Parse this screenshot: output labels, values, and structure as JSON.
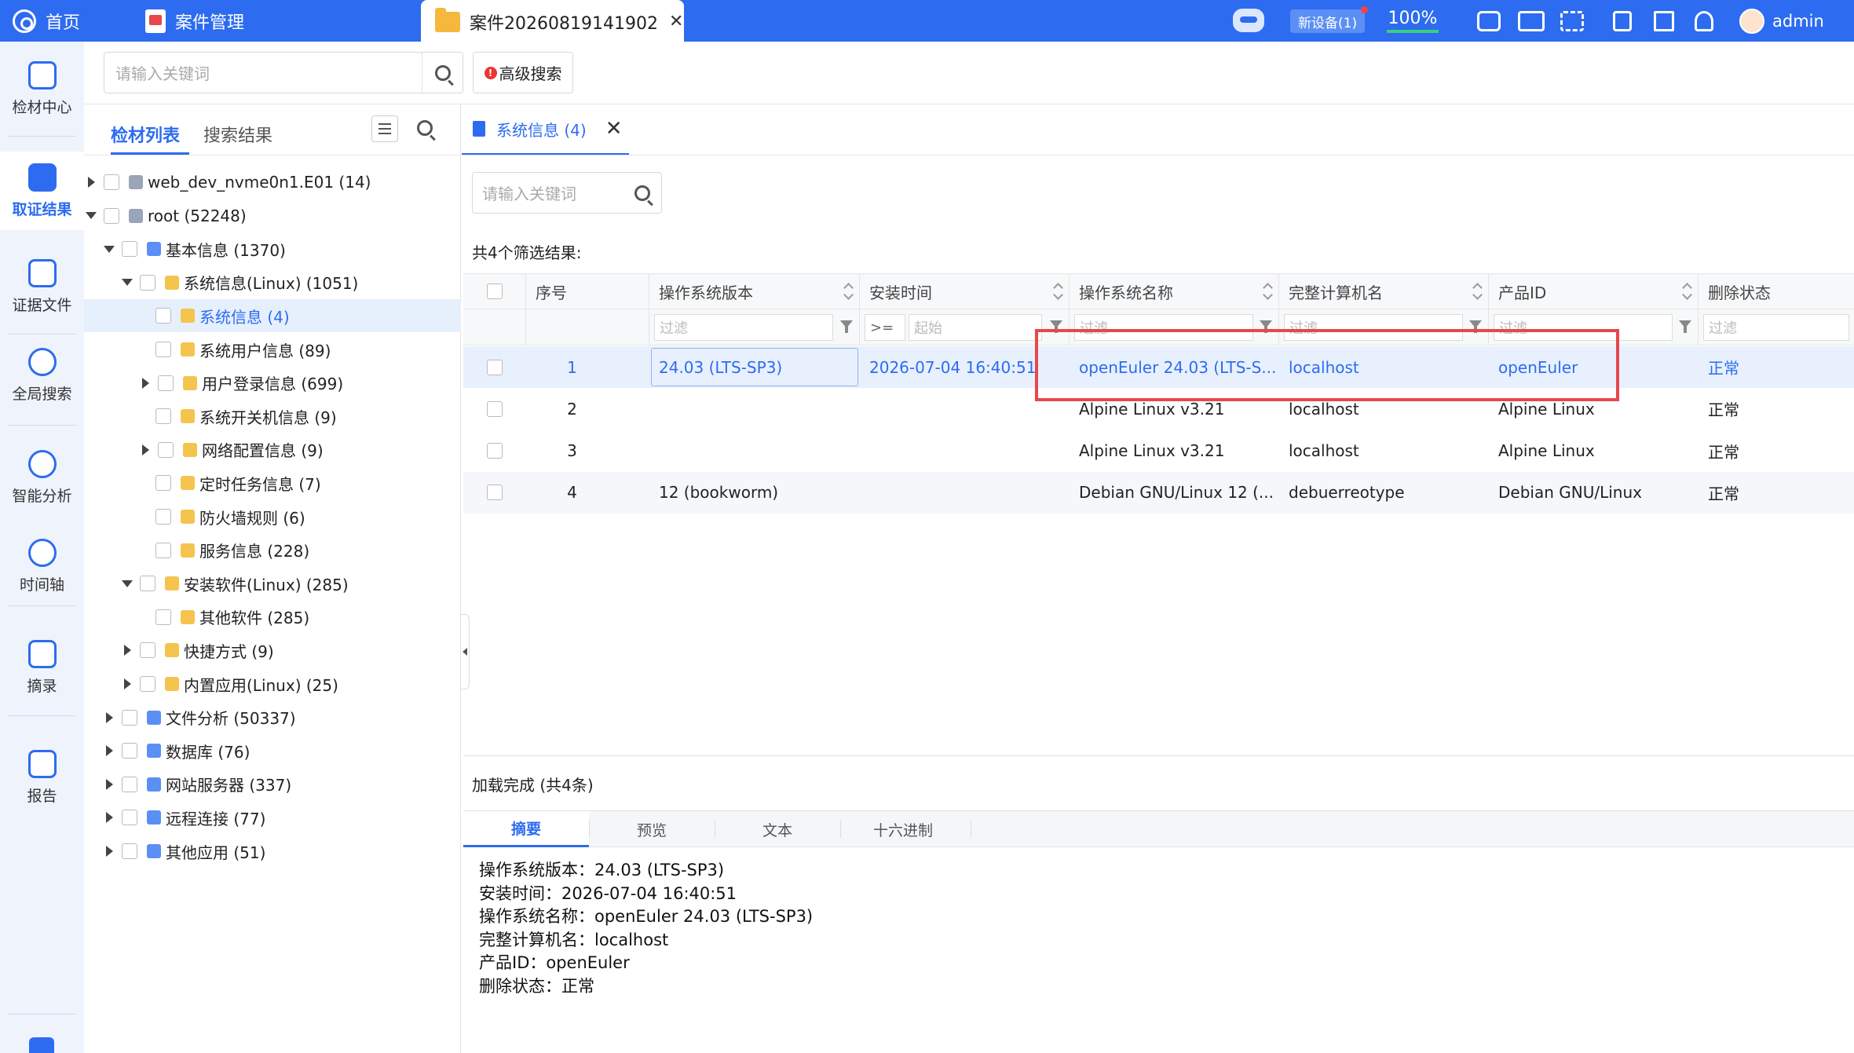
{
  "topbar": {
    "home_label": "首页",
    "case_mgmt_label": "案件管理",
    "active_tab_label": "案件20260819141902",
    "new_device_label": "新设备(1)",
    "zoom": "100%",
    "user": "admin"
  },
  "leftnav": [
    {
      "label": "检材中心",
      "icon": "home-icon"
    },
    {
      "label": "取证结果",
      "icon": "evidence-result-icon",
      "active": true
    },
    {
      "label": "证据文件",
      "icon": "binary-file-icon"
    },
    {
      "label": "全局搜索",
      "icon": "global-search-icon"
    },
    {
      "label": "智能分析",
      "icon": "brain-icon"
    },
    {
      "label": "时间轴",
      "icon": "clock-icon"
    },
    {
      "label": "摘录",
      "icon": "bookmark-icon"
    },
    {
      "label": "报告",
      "icon": "report-icon"
    }
  ],
  "search": {
    "placeholder": "请输入关键词",
    "advanced_label": "高级搜索"
  },
  "panel": {
    "tab_list": "检材列表",
    "tab_results": "搜索结果"
  },
  "tree": [
    {
      "label": "web_dev_nvme0n1.E01 (14)",
      "arrow": "r",
      "indent": 0
    },
    {
      "label": "root (52248)",
      "arrow": "d",
      "indent": 0
    },
    {
      "label": "基本信息 (1370)",
      "arrow": "d",
      "indent": 1
    },
    {
      "label": "系统信息(Linux) (1051)",
      "arrow": "d",
      "indent": 2
    },
    {
      "label": "系统信息 (4)",
      "arrow": "n",
      "indent": 3,
      "selected": true
    },
    {
      "label": "系统用户信息 (89)",
      "arrow": "n",
      "indent": 3
    },
    {
      "label": "用户登录信息 (699)",
      "arrow": "r",
      "indent": 3
    },
    {
      "label": "系统开关机信息 (9)",
      "arrow": "n",
      "indent": 3
    },
    {
      "label": "网络配置信息 (9)",
      "arrow": "r",
      "indent": 3
    },
    {
      "label": "定时任务信息 (7)",
      "arrow": "n",
      "indent": 3
    },
    {
      "label": "防火墙规则 (6)",
      "arrow": "n",
      "indent": 3
    },
    {
      "label": "服务信息 (228)",
      "arrow": "n",
      "indent": 3
    },
    {
      "label": "安装软件(Linux) (285)",
      "arrow": "d",
      "indent": 2
    },
    {
      "label": "其他软件 (285)",
      "arrow": "n",
      "indent": 3
    },
    {
      "label": "快捷方式 (9)",
      "arrow": "r",
      "indent": 2
    },
    {
      "label": "内置应用(Linux) (25)",
      "arrow": "r",
      "indent": 2
    },
    {
      "label": "文件分析 (50337)",
      "arrow": "r",
      "indent": 1
    },
    {
      "label": "数据库 (76)",
      "arrow": "r",
      "indent": 1
    },
    {
      "label": "网站服务器 (337)",
      "arrow": "r",
      "indent": 1
    },
    {
      "label": "远程连接 (77)",
      "arrow": "r",
      "indent": 1
    },
    {
      "label": "其他应用 (51)",
      "arrow": "r",
      "indent": 1
    }
  ],
  "content": {
    "tab_label": "系统信息 (4)",
    "search_placeholder": "请输入关键词",
    "result_count": "共4个筛选结果:",
    "status": "加载完成 (共4条)"
  },
  "table": {
    "columns": [
      "序号",
      "操作系统版本",
      "安装时间",
      "操作系统名称",
      "完整计算机名",
      "产品ID",
      "删除状态"
    ],
    "filter_placeholder": "过滤",
    "date_op": ">=",
    "date_placeholder": "起始",
    "rows": [
      {
        "no": "1",
        "version": "24.03 (LTS-SP3)",
        "install_time": "2026-07-04 16:40:51",
        "os_name": "openEuler 24.03 (LTS-S...",
        "computer": "localhost",
        "product_id": "openEuler",
        "status": "正常"
      },
      {
        "no": "2",
        "version": "",
        "install_time": "",
        "os_name": "Alpine Linux v3.21",
        "computer": "localhost",
        "product_id": "Alpine Linux",
        "status": "正常"
      },
      {
        "no": "3",
        "version": "",
        "install_time": "",
        "os_name": "Alpine Linux v3.21",
        "computer": "localhost",
        "product_id": "Alpine Linux",
        "status": "正常"
      },
      {
        "no": "4",
        "version": "12 (bookworm)",
        "install_time": "",
        "os_name": "Debian GNU/Linux 12 (...",
        "computer": "debuerreotype",
        "product_id": "Debian GNU/Linux",
        "status": "正常"
      }
    ]
  },
  "bottom_tabs": [
    "摘要",
    "预览",
    "文本",
    "十六进制"
  ],
  "details": [
    "操作系统版本：24.03 (LTS-SP3)",
    "安装时间：2026-07-04 16:40:51",
    "操作系统名称：openEuler 24.03 (LTS-SP3)",
    "完整计算机名：localhost",
    "产品ID：openEuler",
    "删除状态：正常"
  ],
  "colors": {
    "accent": "#2d6cf0",
    "highlight_box": "#e8474c"
  }
}
